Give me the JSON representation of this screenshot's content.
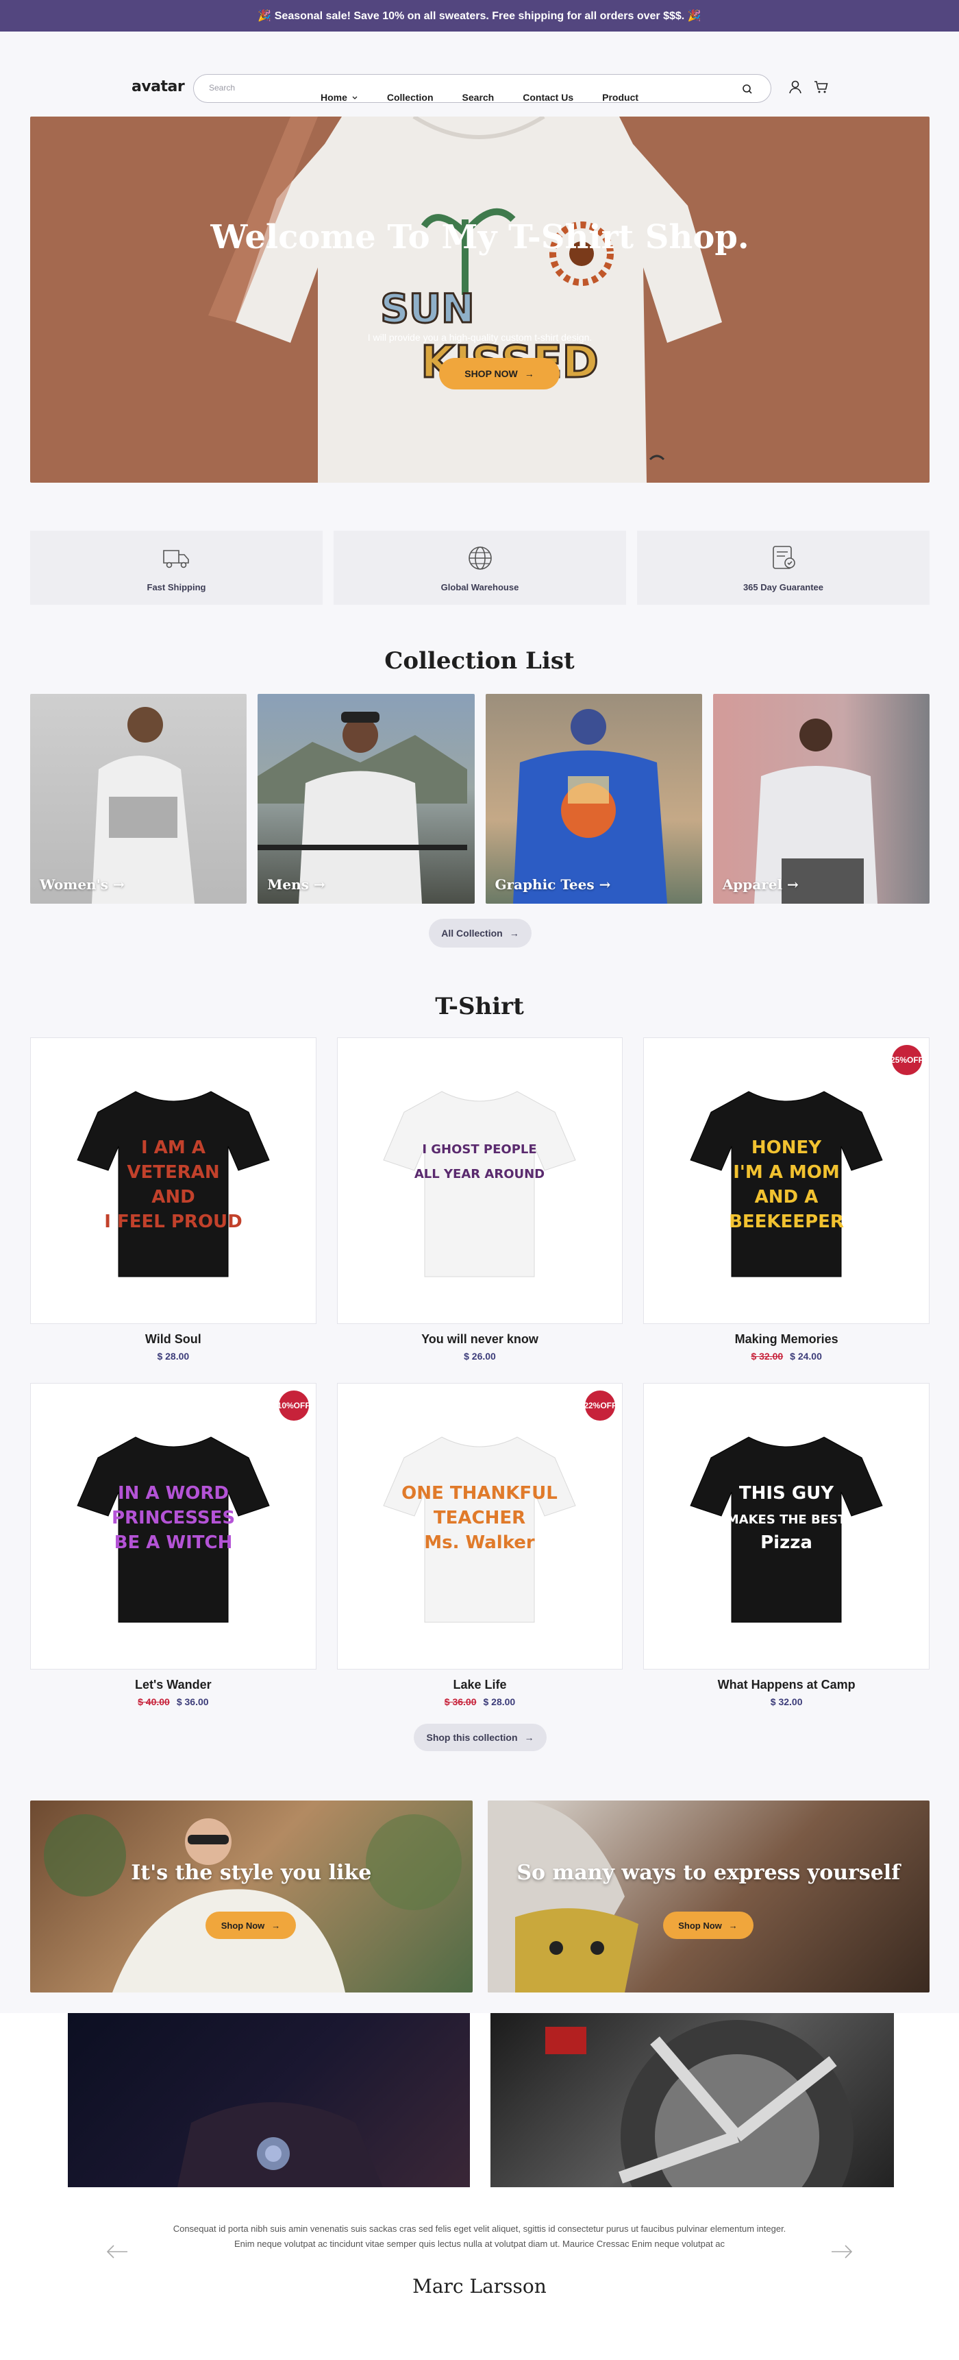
{
  "announcement": "🎉 Seasonal sale! Save 10% on all sweaters. Free shipping for all orders over $$$. 🎉",
  "header": {
    "logo": "avatar",
    "search_placeholder": "Search",
    "icons": [
      "user-icon",
      "cart-icon"
    ]
  },
  "nav": [
    "Home",
    "Collection",
    "Search",
    "Contact Us",
    "Product"
  ],
  "hero": {
    "title": "Welcome To My T-Shirt Shop.",
    "subtitle": "I will provide you a high-quality custom t-shirt design.",
    "button": "SHOP NOW",
    "shirt_print": [
      "SUN",
      "KISSED"
    ]
  },
  "features": [
    {
      "label": "Fast Shipping",
      "icon": "truck-icon"
    },
    {
      "label": "Global Warehouse",
      "icon": "globe-icon"
    },
    {
      "label": "365 Day Guarantee",
      "icon": "guarantee-icon"
    }
  ],
  "collection_section": {
    "title": "Collection List",
    "items": [
      {
        "label": "Women's →"
      },
      {
        "label": "Mens →"
      },
      {
        "label": "Graphic Tees →"
      },
      {
        "label": "Apparel →"
      }
    ],
    "button": "All Collection"
  },
  "tshirt_section": {
    "title": "T-Shirt",
    "products": [
      {
        "name": "Wild Soul",
        "price": "$ 28.00",
        "old_price": "",
        "badge": "",
        "print": [
          "I AM A",
          "VETERAN",
          "AND",
          "I FEEL PROUD"
        ],
        "shirt": "#151515",
        "ink": "#c2412b"
      },
      {
        "name": "You will never know",
        "price": "$ 26.00",
        "old_price": "",
        "badge": "",
        "print": [
          "I GHOST PEOPLE",
          "ALL YEAR AROUND"
        ],
        "shirt": "#f4f4f4",
        "ink": "#5a2a6e"
      },
      {
        "name": "Making Memories",
        "price": "$ 24.00",
        "old_price": "$ 32.00",
        "badge": "25% OFF",
        "print": [
          "HONEY",
          "I'M A MOM",
          "AND A",
          "BEEKEEPER"
        ],
        "shirt": "#151515",
        "ink": "#f2c230"
      },
      {
        "name": "Let's Wander",
        "price": "$ 36.00",
        "old_price": "$ 40.00",
        "badge": "10% OFF",
        "print": [
          "IN A WORD",
          "PRINCESSES",
          "BE A WITCH"
        ],
        "shirt": "#151515",
        "ink": "#b453d6"
      },
      {
        "name": "Lake Life",
        "price": "$ 28.00",
        "old_price": "$ 36.00",
        "badge": "22% OFF",
        "print": [
          "ONE THANKFUL",
          "TEACHER",
          "Ms. Walker"
        ],
        "shirt": "#f4f4f4",
        "ink": "#e07a2a"
      },
      {
        "name": "What Happens at Camp",
        "price": "$ 32.00",
        "old_price": "",
        "badge": "",
        "print": [
          "THIS GUY",
          "MAKES THE BEST",
          "Pizza"
        ],
        "shirt": "#151515",
        "ink": "#ffffff"
      }
    ],
    "button": "Shop this collection"
  },
  "promos": [
    {
      "title": "It's the style you like",
      "button": "Shop Now"
    },
    {
      "title": "So many ways to express yourself",
      "button": "Shop Now"
    }
  ],
  "testimonial": {
    "quote": "Consequat id porta nibh suis amin venenatis suis sackas cras sed felis eget velit aliquet, sgittis id consectetur purus ut faucibus pulvinar elementum integer. Enim neque volutpat ac tincidunt vitae semper quis lectus nulla at volutpat diam ut. Maurice Cressac Enim neque volutpat ac",
    "author": "Marc Larsson"
  },
  "colors": {
    "announcement_bg": "#53467f",
    "hero_bg": "#a4694f",
    "accent": "#f0a63c",
    "sale_badge": "#c7223a"
  }
}
